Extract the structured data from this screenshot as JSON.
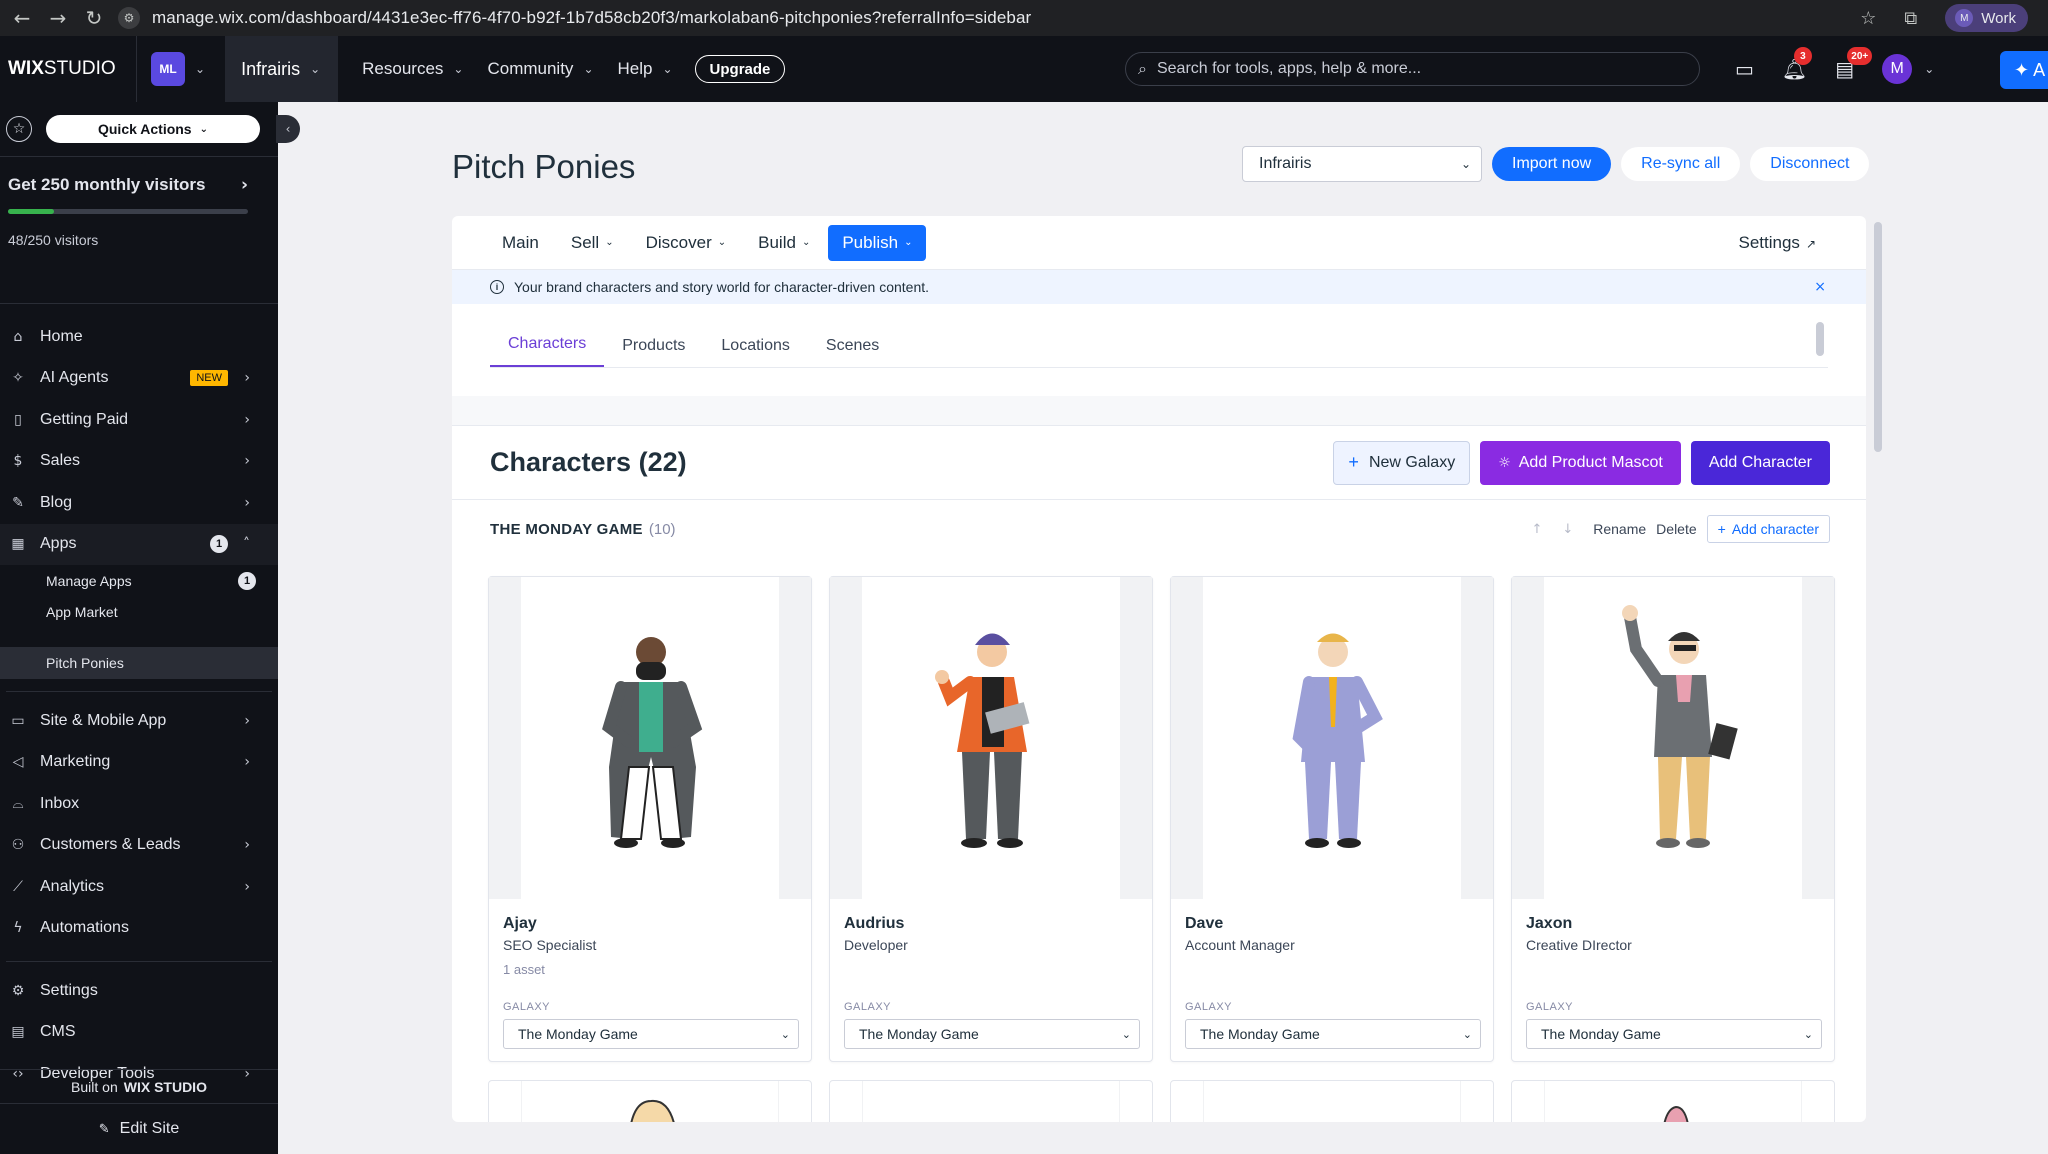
{
  "browser": {
    "url": "manage.wix.com/dashboard/4431e3ec-ff76-4f70-b92f-1b7d58cb20f3/markolaban6-pitchponies?referralInfo=sidebar",
    "profile_initial": "M",
    "profile_label": "Work"
  },
  "topbar": {
    "logo_bold": "WIX",
    "logo_rest": "STUDIO",
    "workspace_initials": "ML",
    "site_name": "Infrairis",
    "menu": [
      "Resources",
      "Community",
      "Help"
    ],
    "upgrade_label": "Upgrade",
    "search_placeholder": "Search for tools, apps, help & more...",
    "notifications_count": "3",
    "updates_count": "20+",
    "user_initial": "M",
    "ai_label": "A"
  },
  "sidebar": {
    "quick_actions": "Quick Actions",
    "visitors_title": "Get 250 monthly visitors",
    "visitors_progress": 0.19,
    "visitors_count": "48/250 visitors",
    "items": [
      {
        "label": "Home",
        "icon": "home-icon"
      },
      {
        "label": "AI Agents",
        "icon": "sparkle-icon",
        "tag": "NEW"
      },
      {
        "label": "Getting Paid",
        "icon": "receipt-icon"
      },
      {
        "label": "Sales",
        "icon": "dollar-icon"
      },
      {
        "label": "Blog",
        "icon": "pen-icon"
      },
      {
        "label": "Apps",
        "icon": "apps-icon",
        "count": "1"
      }
    ],
    "apps_sub": [
      {
        "label": "Manage Apps",
        "count": "1"
      },
      {
        "label": "App Market"
      }
    ],
    "active_app": "Pitch Ponies",
    "items2": [
      {
        "label": "Site & Mobile App",
        "icon": "devices-icon"
      },
      {
        "label": "Marketing",
        "icon": "megaphone-icon"
      },
      {
        "label": "Inbox",
        "icon": "inbox-icon"
      },
      {
        "label": "Customers & Leads",
        "icon": "people-icon"
      },
      {
        "label": "Analytics",
        "icon": "chart-icon"
      },
      {
        "label": "Automations",
        "icon": "bolt-icon"
      }
    ],
    "items3": [
      {
        "label": "Settings",
        "icon": "gear-icon"
      },
      {
        "label": "CMS",
        "icon": "database-icon"
      },
      {
        "label": "Developer Tools",
        "icon": "code-icon"
      }
    ],
    "built_on": "Built on",
    "built_on_brand": "WIX STUDIO",
    "edit_site": "Edit Site"
  },
  "page": {
    "title": "Pitch Ponies",
    "site_select": "Infrairis",
    "import_now": "Import now",
    "resync_all": "Re-sync all",
    "disconnect": "Disconnect"
  },
  "app_nav": {
    "tabs": [
      "Main",
      "Sell",
      "Discover",
      "Build",
      "Publish"
    ],
    "settings": "Settings",
    "banner": "Your brand characters and story world for character-driven content."
  },
  "sub_tabs": [
    "Characters",
    "Products",
    "Locations",
    "Scenes"
  ],
  "characters": {
    "title": "Characters (22)",
    "new_galaxy": "New Galaxy",
    "add_mascot": "Add Product Mascot",
    "add_character": "Add Character"
  },
  "galaxy": {
    "name": "THE MONDAY GAME",
    "count": "(10)",
    "rename": "Rename",
    "delete": "Delete",
    "add_character": "Add character",
    "label": "GALAXY"
  },
  "cards": [
    {
      "name": "Ajay",
      "role": "SEO Specialist",
      "assets": "1 asset",
      "galaxy": "The Monday Game"
    },
    {
      "name": "Audrius",
      "role": "Developer",
      "assets": "",
      "galaxy": "The Monday Game"
    },
    {
      "name": "Dave",
      "role": "Account Manager",
      "assets": "",
      "galaxy": "The Monday Game"
    },
    {
      "name": "Jaxon",
      "role": "Creative DIrector",
      "assets": "",
      "galaxy": "The Monday Game"
    }
  ],
  "colors": {
    "primary_blue": "#116dff",
    "purple": "#8a2be2",
    "indigo": "#4a27d8",
    "tab_active": "#6b3fd6",
    "sidebar_bg": "#101218"
  }
}
